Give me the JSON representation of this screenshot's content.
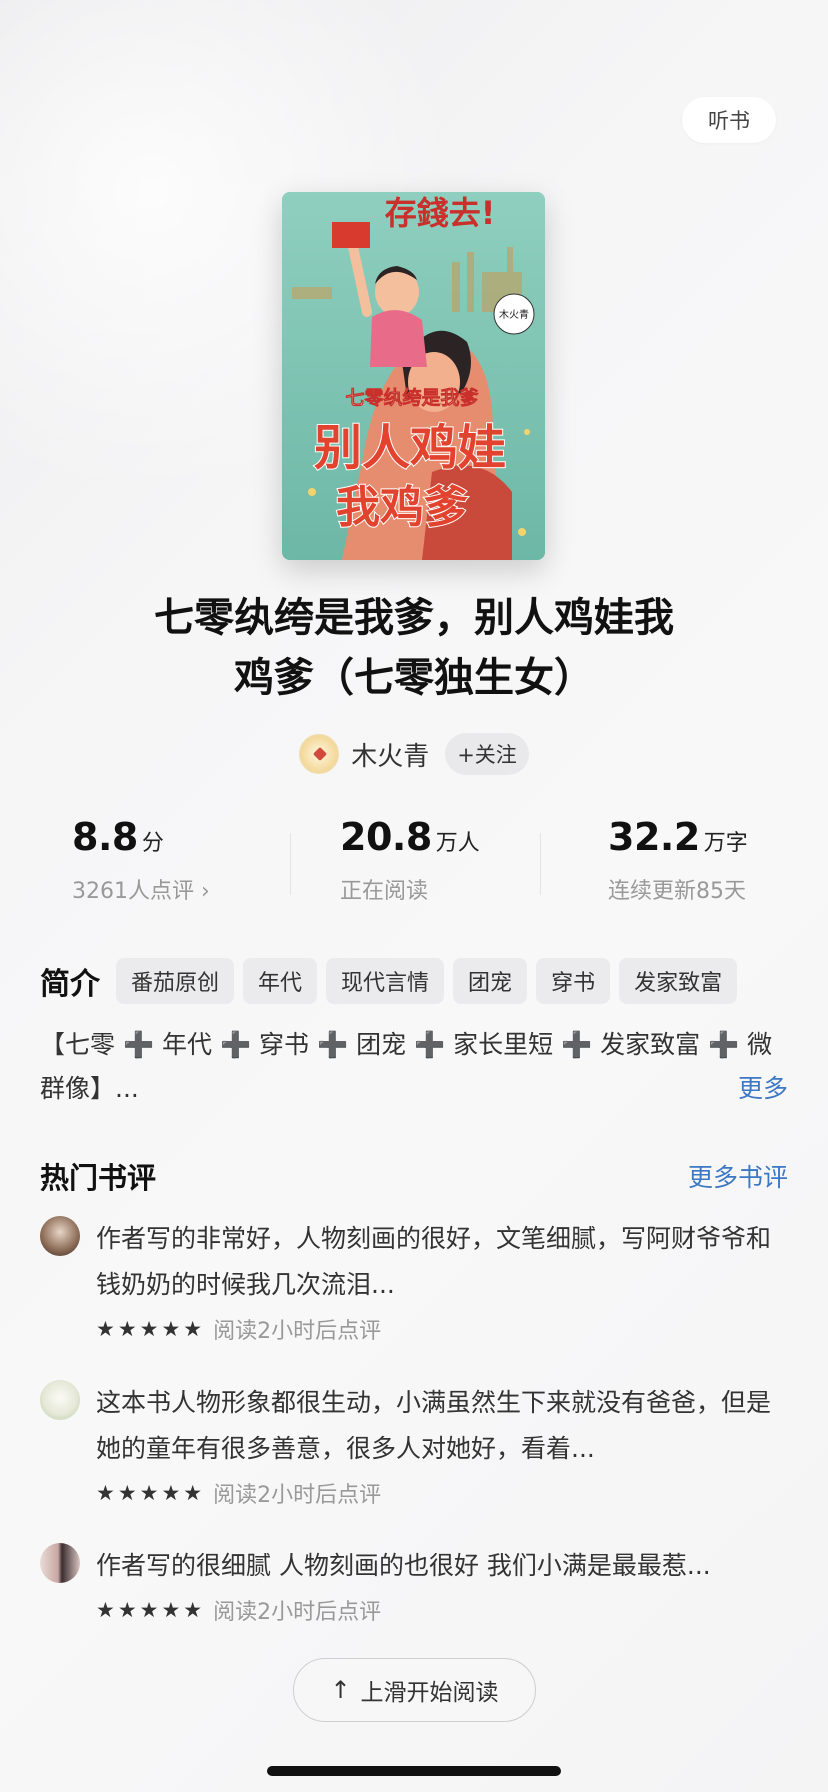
{
  "header": {
    "listen_label": "听书"
  },
  "book": {
    "cover_top_text": "存錢去!",
    "cover_author_badge": "木火青",
    "cover_subtitle": "七零纨绔是我爹",
    "cover_title_line1": "别人鸡娃",
    "cover_title_line2": "我鸡爹",
    "title_line1": "七零纨绔是我爹，别人鸡娃我",
    "title_line2": "鸡爹（七零独生女）"
  },
  "author": {
    "name": "木火青",
    "follow_label": "+关注"
  },
  "stats": {
    "rating": {
      "value": "8.8",
      "unit": "分",
      "sub": "3261人点评 ›"
    },
    "readers": {
      "value": "20.8",
      "unit": "万人",
      "sub": "正在阅读"
    },
    "words": {
      "value": "32.2",
      "unit": "万字",
      "sub": "连续更新85天"
    }
  },
  "intro": {
    "label": "简介",
    "tags": [
      "番茄原创",
      "年代",
      "现代言情",
      "团宠",
      "穿书",
      "发家致富"
    ],
    "text_line1": "【七零 ➕ 年代 ➕ 穿书 ➕ 团宠 ➕ 家长里短 ➕ 发家致富 ➕ 微",
    "text_line2": "群像】...",
    "more_label": "更多"
  },
  "reviews": {
    "title": "热门书评",
    "more_label": "更多书评",
    "items": [
      {
        "text": "作者写的非常好，人物刻画的很好，文笔细腻，写阿财爷爷和钱奶奶的时候我几次流泪...",
        "stars": "★★★★★",
        "meta": "阅读2小时后点评"
      },
      {
        "text": "这本书人物形象都很生动，小满虽然生下来就没有爸爸，但是她的童年有很多善意，很多人对她好，看着...",
        "stars": "★★★★★",
        "meta": "阅读2小时后点评"
      },
      {
        "text": "作者写的很细腻 人物刻画的也很好 我们小满是最最惹...",
        "stars": "★★★★★",
        "meta": "阅读2小时后点评"
      }
    ]
  },
  "footer": {
    "swipe_label": "上滑开始阅读"
  }
}
